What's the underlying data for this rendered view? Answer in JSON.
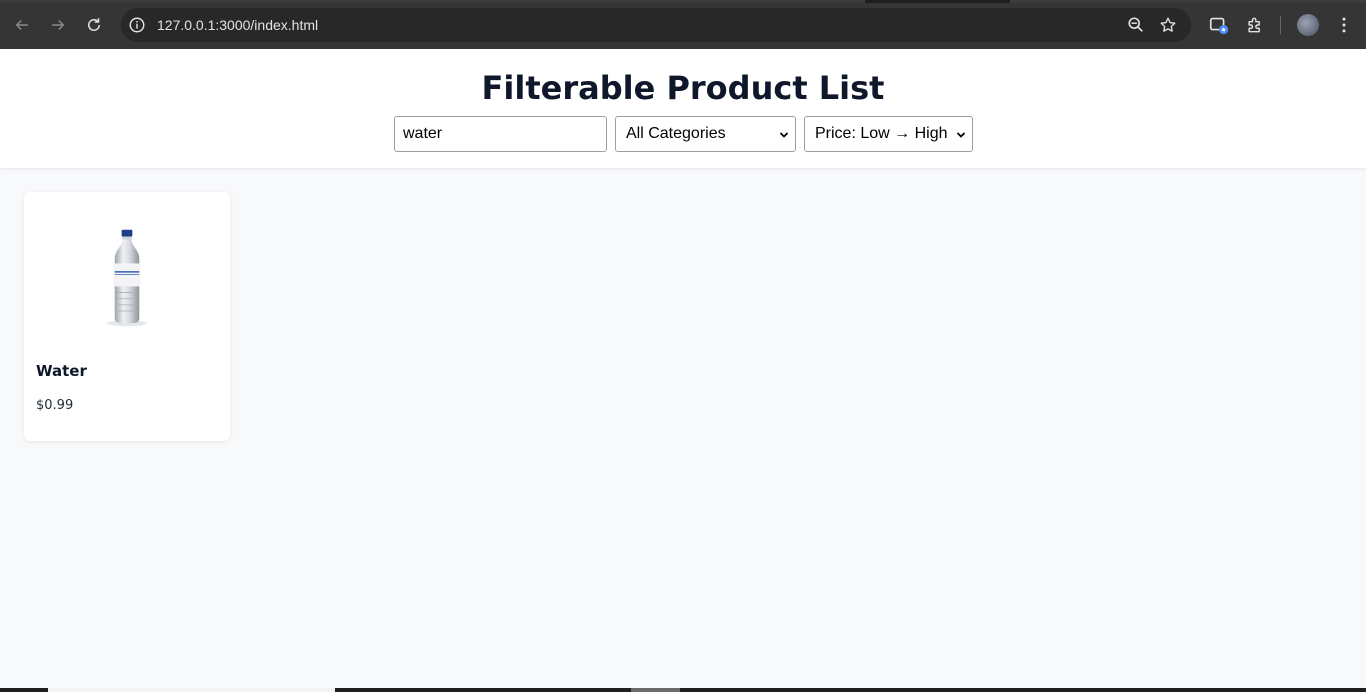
{
  "browser": {
    "url": "127.0.0.1:3000/index.html",
    "back_icon": "arrow-left-icon",
    "forward_icon": "arrow-right-icon",
    "reload_icon": "reload-icon",
    "info_icon": "info-icon",
    "zoom_icon": "zoom-out-icon",
    "bookmark_icon": "star-icon",
    "extensions_icon": "puzzle-icon",
    "menu_icon": "kebab-menu-icon"
  },
  "header": {
    "title": "Filterable Product List"
  },
  "filters": {
    "search_value": "water",
    "category_selected": "All Categories",
    "sort_selected": "Price: Low → High"
  },
  "products": [
    {
      "name": "Water",
      "price": "$0.99",
      "image_icon": "water-bottle-image"
    }
  ],
  "colors": {
    "title": "#0f172a",
    "page_background": "#f8f9fb",
    "chrome": "#353535"
  }
}
